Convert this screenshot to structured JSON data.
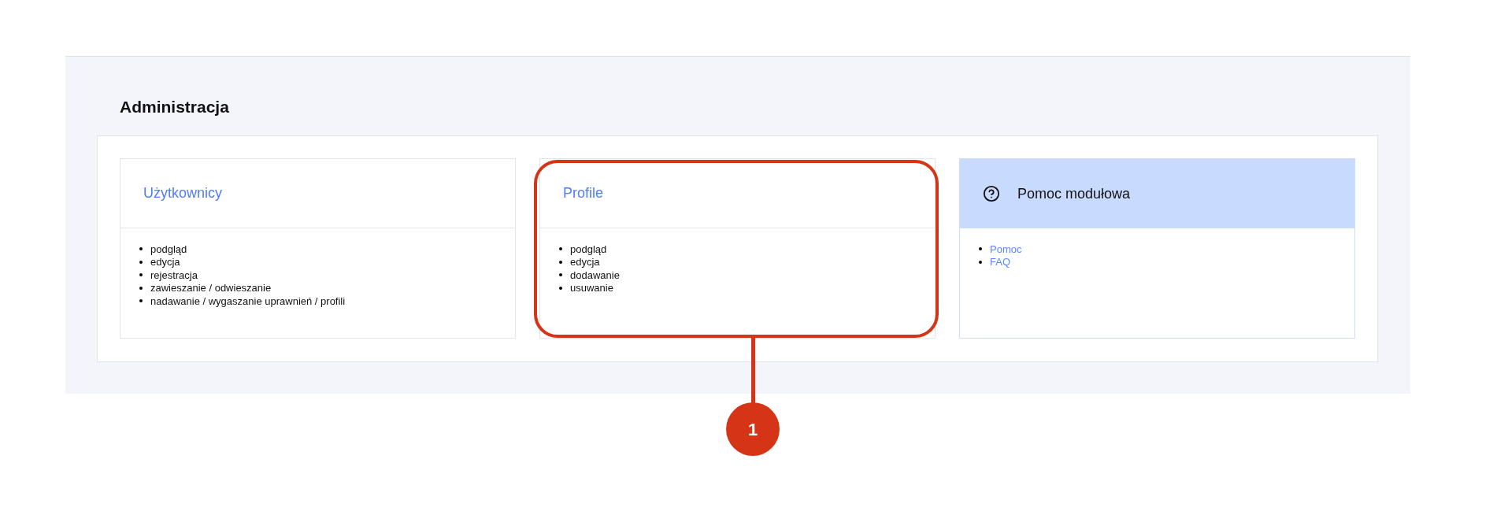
{
  "section_title": "Administracja",
  "cards": [
    {
      "kind": "module",
      "title": "Użytkownicy",
      "items": [
        "podgląd",
        "edycja",
        "rejestracja",
        "zawieszanie / odwieszanie",
        "nadawanie / wygaszanie uprawnień / profili"
      ]
    },
    {
      "kind": "module",
      "title": "Profile",
      "items": [
        "podgląd",
        "edycja",
        "dodawanie",
        "usuwanie"
      ],
      "callout": "1"
    },
    {
      "kind": "help",
      "title": "Pomoc modułowa",
      "items": [
        "Pomoc",
        "FAQ"
      ]
    }
  ]
}
